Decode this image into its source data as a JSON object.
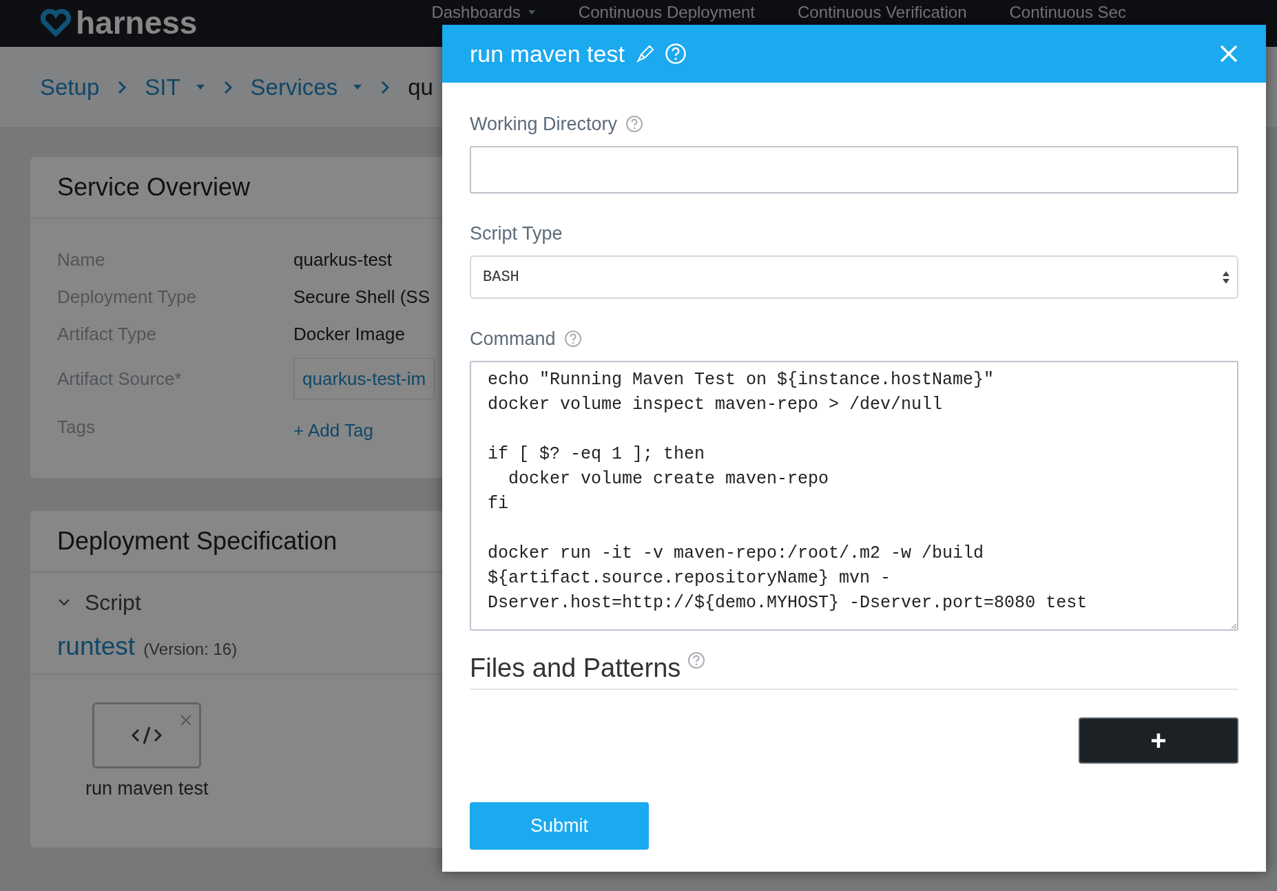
{
  "top_bar": {
    "logo": "harness",
    "nav": [
      {
        "label": "Dashboards",
        "dropdown": true
      },
      {
        "label": "Continuous Deployment",
        "dropdown": false
      },
      {
        "label": "Continuous Verification",
        "dropdown": false
      },
      {
        "label": "Continuous Sec",
        "dropdown": false
      }
    ]
  },
  "breadcrumb": [
    {
      "label": "Setup",
      "kind": "link"
    },
    {
      "label": "SIT",
      "kind": "dropdown"
    },
    {
      "label": "Services",
      "kind": "dropdown"
    },
    {
      "label": "qu",
      "kind": "current"
    }
  ],
  "service_overview": {
    "title": "Service Overview",
    "fields": [
      {
        "label": "Name",
        "value": "quarkus-test",
        "kind": "text"
      },
      {
        "label": "Deployment Type",
        "value": "Secure Shell (SS",
        "kind": "text"
      },
      {
        "label": "Artifact Type",
        "value": "Docker Image",
        "kind": "text"
      },
      {
        "label": "Artifact Source*",
        "value": "quarkus-test-im",
        "kind": "field"
      },
      {
        "label": "Tags",
        "value": "+ Add Tag",
        "kind": "link"
      }
    ]
  },
  "deployment_specification": {
    "title": "Deployment Specification",
    "section": {
      "label": "Script",
      "expanded": true
    },
    "script_name": "runtest",
    "version": "(Version: 16)",
    "steps": [
      {
        "label": "run maven test"
      }
    ]
  },
  "dialog": {
    "title": "run maven test",
    "working_directory": {
      "label": "Working Directory"
    },
    "script_type": {
      "label": "Script Type",
      "value": "BASH"
    },
    "command": {
      "label": "Command",
      "value": "echo \"Running Maven Test on ${instance.hostName}\"\ndocker volume inspect maven-repo > /dev/null\n\nif [ $? -eq 1 ]; then\n  docker volume create maven-repo\nfi\n\ndocker run -it -v maven-repo:/root/.m2 -w /build ${artifact.source.repositoryName} mvn -Dserver.host=http://${demo.MYHOST} -Dserver.port=8080 test"
    },
    "files_and_patterns": {
      "title": "Files and Patterns"
    },
    "add_button": "+",
    "submit_button": "Submit"
  }
}
